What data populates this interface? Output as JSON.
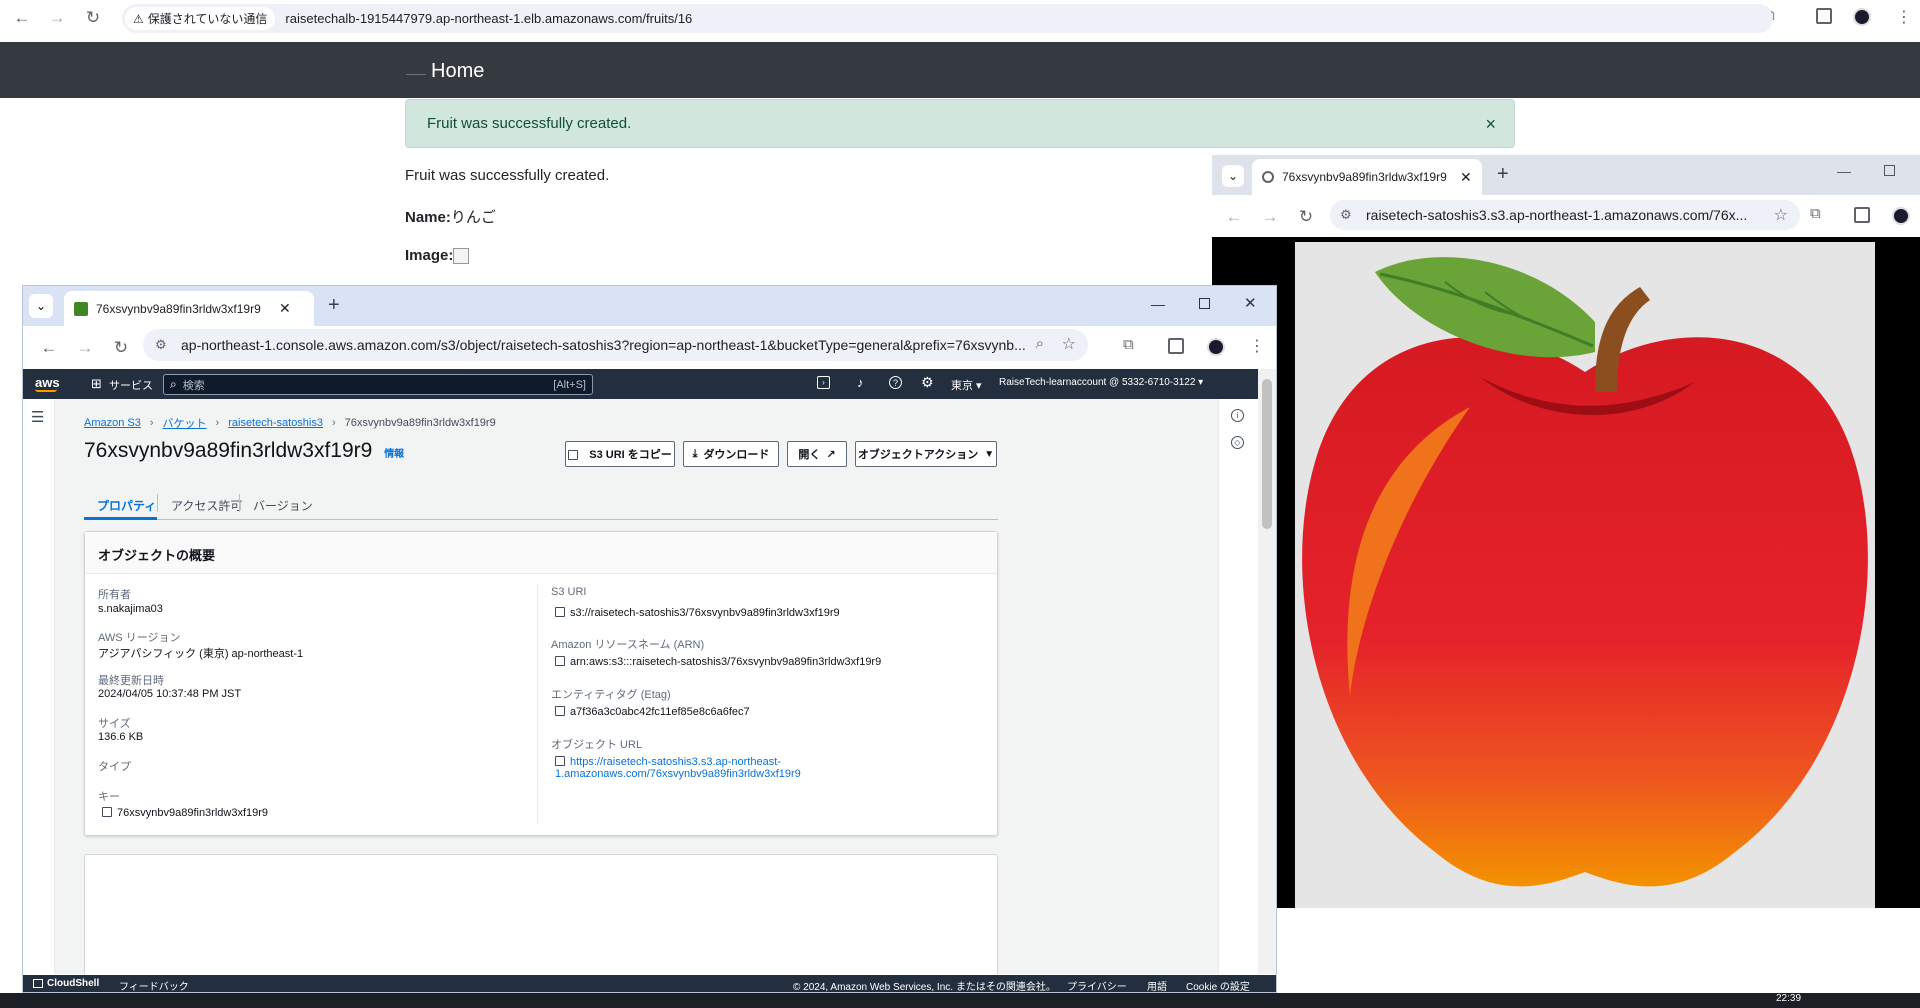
{
  "back_browser": {
    "security_label": "保護されていない通信",
    "url": "raisetechalb-1915447979.ap-northeast-1.elb.amazonaws.com/fruits/16",
    "nav_home": "Home",
    "alert_text": "Fruit was successfully created.",
    "alert_close": "×",
    "notice": "Fruit was successfully created.",
    "name_label": "Name:",
    "name_value": "りんご",
    "image_label": "Image:"
  },
  "apple_window": {
    "tab_title": "76xsvynbv9a89fin3rldw3xf19r9",
    "url": "raisetech-satoshis3.s3.ap-northeast-1.amazonaws.com/76x..."
  },
  "aws_window": {
    "tab_title": "76xsvynbv9a89fin3rldw3xf19r9",
    "url": "ap-northeast-1.console.aws.amazon.com/s3/object/raisetech-satoshis3?region=ap-northeast-1&bucketType=general&prefix=76xsvynb...",
    "header": {
      "logo": "aws",
      "services": "サービス",
      "search_placeholder": "検索",
      "search_shortcut": "[Alt+S]",
      "region": "東京",
      "account": "RaiseTech-learnaccount @ 5332-6710-3122"
    },
    "breadcrumbs": [
      "Amazon S3",
      "バケット",
      "raisetech-satoshis3",
      "76xsvynbv9a89fin3rldw3xf19r9"
    ],
    "title": "76xsvynbv9a89fin3rldw3xf19r9",
    "info_link": "情報",
    "buttons": {
      "copy_uri": "S3 URI をコピー",
      "download": "ダウンロード",
      "open": "開く",
      "actions": "オブジェクトアクション"
    },
    "tabs": [
      "プロパティ",
      "アクセス許可",
      "バージョン"
    ],
    "panel_title": "オブジェクトの概要",
    "fields_left": [
      {
        "label": "所有者",
        "value": "s.nakajima03"
      },
      {
        "label": "AWS リージョン",
        "value": "アジアパシフィック (東京) ap-northeast-1"
      },
      {
        "label": "最終更新日時",
        "value": "2024/04/05 10:37:48 PM JST"
      },
      {
        "label": "サイズ",
        "value": "136.6 KB"
      },
      {
        "label": "タイプ",
        "value": ""
      },
      {
        "label": "キー",
        "value": "76xsvynbv9a89fin3rldw3xf19r9"
      }
    ],
    "fields_right": [
      {
        "label": "S3 URI",
        "value": "s3://raisetech-satoshis3/76xsvynbv9a89fin3rldw3xf19r9"
      },
      {
        "label": "Amazon リソースネーム (ARN)",
        "value": "arn:aws:s3:::raisetech-satoshis3/76xsvynbv9a89fin3rldw3xf19r9"
      },
      {
        "label": "エンティティタグ (Etag)",
        "value": "a7f36a3c0abc42fc11ef85e8c6a6fec7"
      },
      {
        "label": "オブジェクト URL",
        "value": "https://raisetech-satoshis3.s3.ap-northeast-1.amazonaws.com/76xsvynbv9a89fin3rldw3xf19r9"
      }
    ],
    "footer": {
      "cloudshell": "CloudShell",
      "feedback": "フィードバック",
      "copyright": "© 2024, Amazon Web Services, Inc. またはその関連会社。",
      "privacy": "プライバシー",
      "terms": "用語",
      "cookies": "Cookie の設定"
    }
  },
  "taskbar": {
    "time": "22:39"
  },
  "colors": {
    "aws_header": "#232f3e",
    "aws_link": "#0972d3",
    "alert_bg": "#d1e7dd",
    "navbar_dark": "#343a40"
  }
}
